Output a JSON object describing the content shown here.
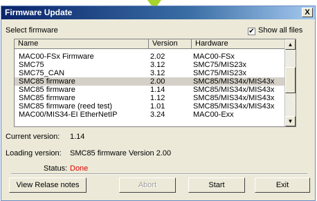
{
  "window": {
    "title": "Firmware Update",
    "close_glyph": "X"
  },
  "select_label": "Select firmware",
  "show_all_label": "Show all files",
  "show_all_checked": true,
  "columns": [
    "Name",
    "Version",
    "Hardware"
  ],
  "rows": [
    {
      "name": "MAC00-FSx Firmware",
      "version": "2.02",
      "hardware": "MAC00-FSx"
    },
    {
      "name": "SMC75",
      "version": "3.12",
      "hardware": "SMC75/MIS23x"
    },
    {
      "name": "SMC75_CAN",
      "version": "3.12",
      "hardware": "SMC75/MIS23x"
    },
    {
      "name": "SMC85 firmware",
      "version": "2.00",
      "hardware": "SMC85/MIS34x/MIS43x"
    },
    {
      "name": "SMC85 firmware",
      "version": "1.14",
      "hardware": "SMC85/MIS34x/MIS43x"
    },
    {
      "name": "SMC85 firmware",
      "version": "1.12",
      "hardware": "SMC85/MIS34x/MIS43x"
    },
    {
      "name": "SMC85 firmware (reed test)",
      "version": "1.01",
      "hardware": "SMC85/MIS34x/MIS43x"
    },
    {
      "name": "MAC00/MIS34-EI EtherNetIP",
      "version": "3.24",
      "hardware": "MAC00-Exx"
    }
  ],
  "selected_row_index": 3,
  "current_version": {
    "label": "Current version:",
    "value": "1.14"
  },
  "loading_version": {
    "label": "Loading version:",
    "value": "SMC85 firmware Version 2.00"
  },
  "status": {
    "label": "Status:",
    "value": "Done",
    "color": "#e00000"
  },
  "buttons": {
    "release_notes": "View Relase notes",
    "abort": "Abort",
    "start": "Start",
    "exit": "Exit"
  },
  "icons": {
    "checkbox": "check-icon",
    "scroll_up": "up-arrow-icon",
    "scroll_down": "down-arrow-icon"
  },
  "colors": {
    "titlebar_start": "#0a246a",
    "titlebar_end": "#a6caf0",
    "selection": "#d4d0c8"
  }
}
